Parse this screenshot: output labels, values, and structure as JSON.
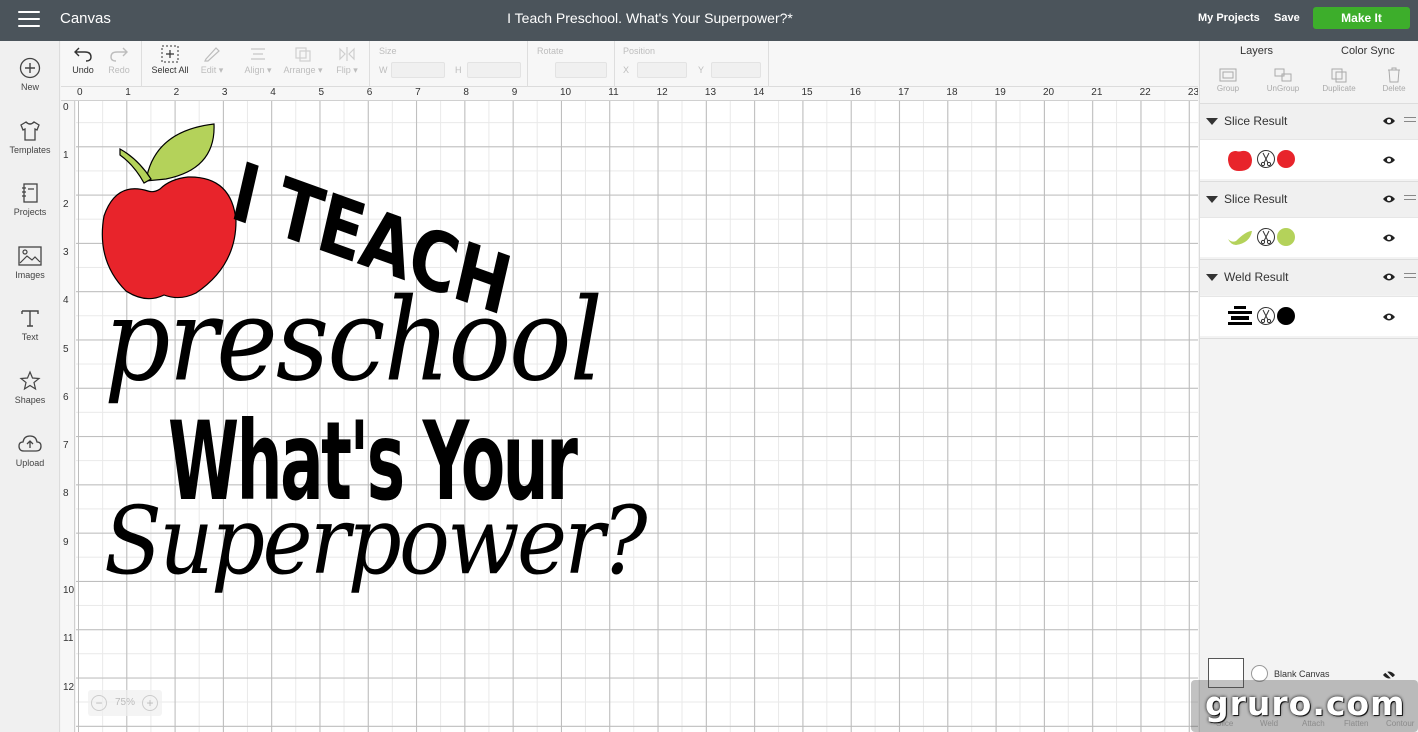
{
  "topbar": {
    "app_name": "Canvas",
    "title": "I Teach Preschool. What's Your Superpower?*",
    "my_projects": "My Projects",
    "save": "Save",
    "make_it": "Make It"
  },
  "sidebar": {
    "items": [
      {
        "label": "New",
        "icon": "plus-circle-icon"
      },
      {
        "label": "Templates",
        "icon": "tshirt-icon"
      },
      {
        "label": "Projects",
        "icon": "notebook-icon"
      },
      {
        "label": "Images",
        "icon": "image-icon"
      },
      {
        "label": "Text",
        "icon": "text-icon"
      },
      {
        "label": "Shapes",
        "icon": "shapes-icon"
      },
      {
        "label": "Upload",
        "icon": "cloud-upload-icon"
      }
    ]
  },
  "toolbar": {
    "undo": "Undo",
    "redo": "Redo",
    "select_all": "Select All",
    "edit": "Edit",
    "align": "Align",
    "arrange": "Arrange",
    "flip": "Flip",
    "size_label": "Size",
    "w_label": "W",
    "h_label": "H",
    "rotate_label": "Rotate",
    "position_label": "Position",
    "x_label": "X",
    "y_label": "Y"
  },
  "rulers": {
    "top": [
      "0",
      "1",
      "2",
      "3",
      "4",
      "5",
      "6",
      "7",
      "8",
      "9",
      "10",
      "11",
      "12",
      "13",
      "14",
      "15",
      "16",
      "17",
      "18",
      "19",
      "20",
      "21",
      "22",
      "23"
    ],
    "left": [
      "0",
      "1",
      "2",
      "3",
      "4",
      "5",
      "6",
      "7",
      "8",
      "9",
      "10",
      "11",
      "12"
    ]
  },
  "design": {
    "line1": "I TEACH",
    "line2": "preschool",
    "line3": "What's Your",
    "line4": "Superpower?",
    "apple_color": "#e8242b",
    "leaf_color": "#b4d25a"
  },
  "zoom": {
    "value": "75%",
    "minus": "−",
    "plus": "+"
  },
  "panel": {
    "tabs": [
      "Layers",
      "Color Sync"
    ],
    "tools": [
      "Group",
      "UnGroup",
      "Duplicate",
      "Delete"
    ],
    "layers": [
      {
        "name": "Slice Result",
        "color": "#e8242b"
      },
      {
        "name": "Slice Result",
        "color": "#b4d25a"
      },
      {
        "name": "Weld Result",
        "color": "#000000"
      }
    ],
    "blank_canvas": "Blank Canvas",
    "bottom_tools": [
      "Slice",
      "Weld",
      "Attach",
      "Flatten",
      "Contour"
    ]
  },
  "watermark": "gruro.com"
}
